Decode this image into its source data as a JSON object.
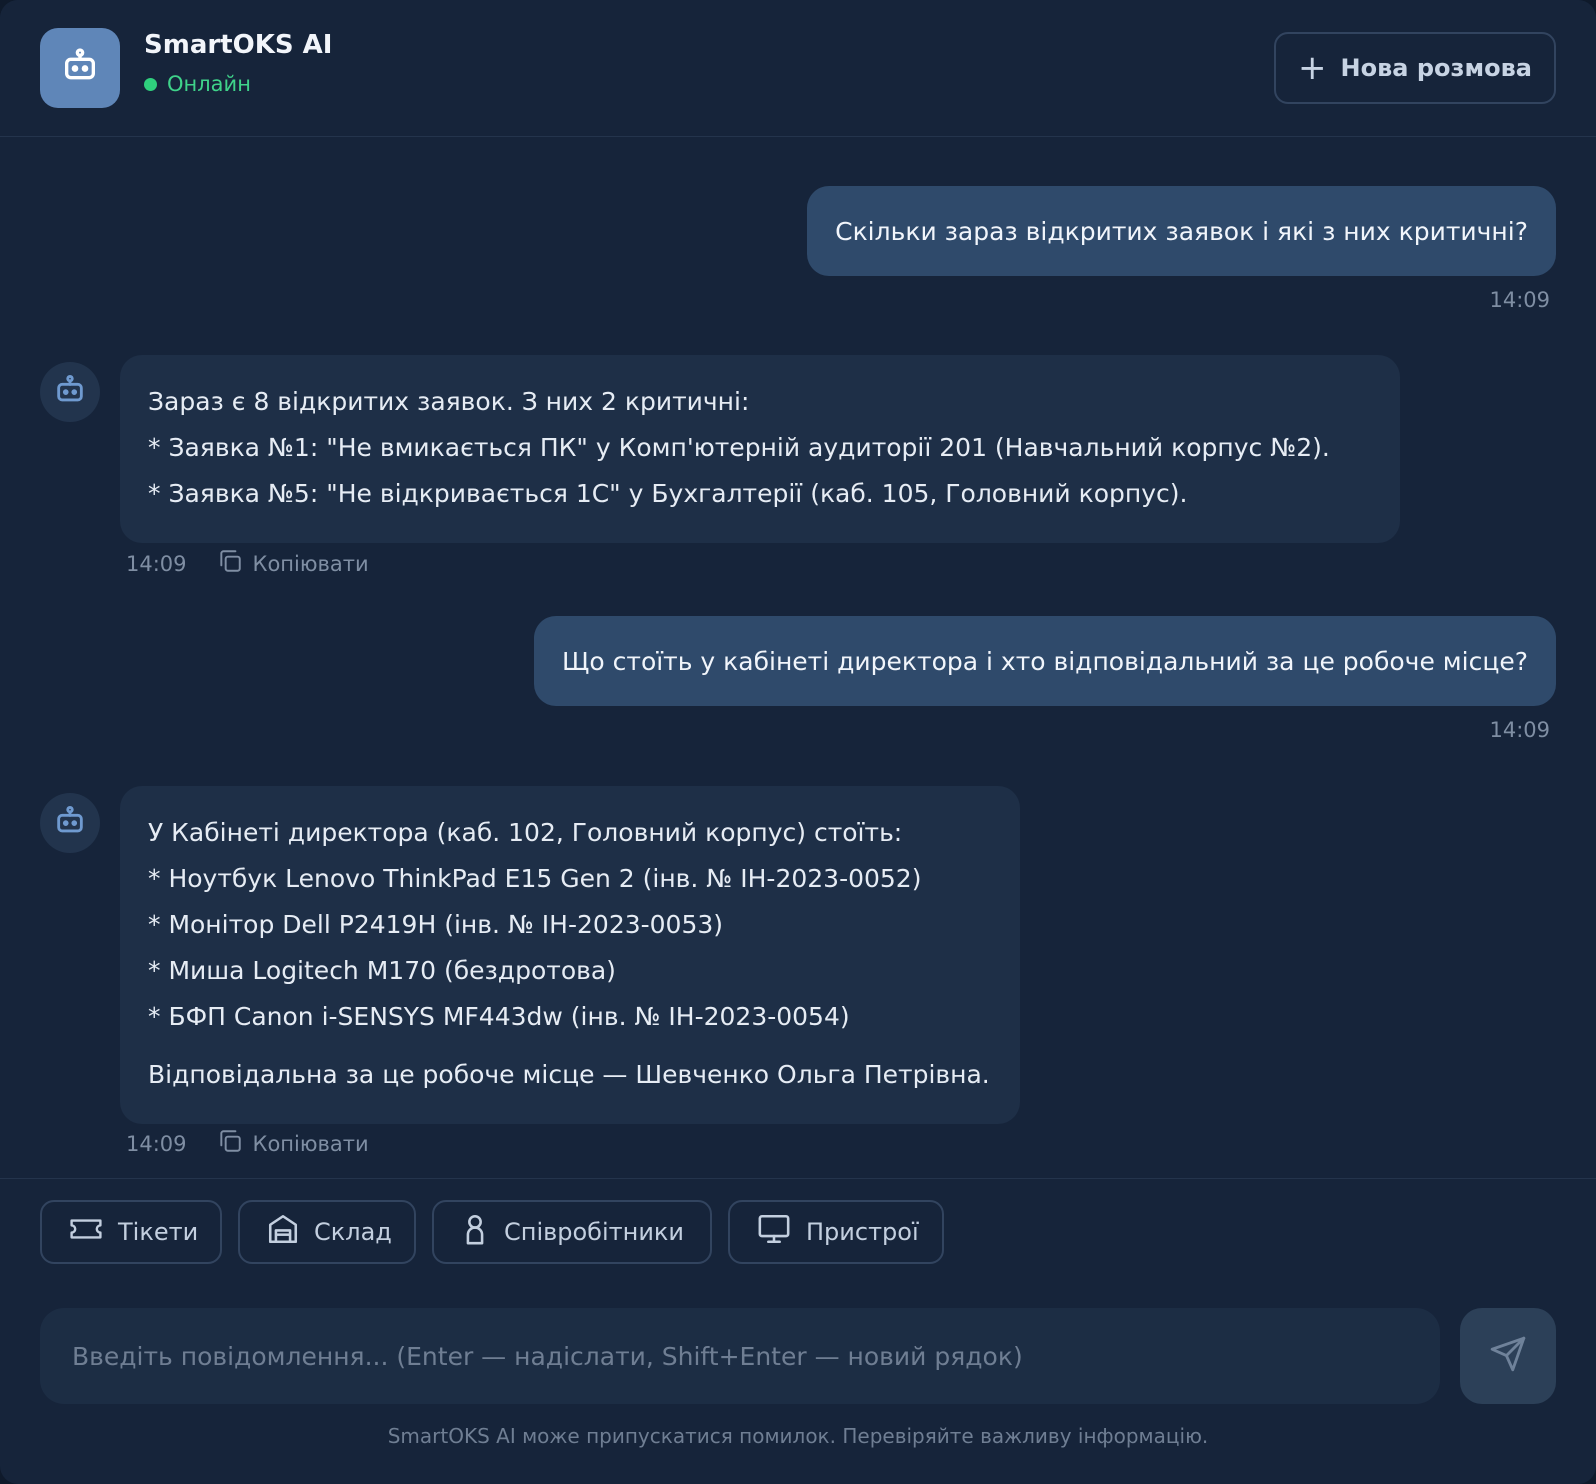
{
  "header": {
    "title": "SmartOKS AI",
    "status": "Онлайн",
    "new_chat_label": "Нова розмова"
  },
  "messages": [
    {
      "role": "user",
      "text": "Скільки зараз відкритих заявок і які з них критичні?",
      "time": "14:09"
    },
    {
      "role": "assistant",
      "lines": [
        "Зараз є 8 відкритих заявок. З них 2 критичні:",
        "* Заявка №1: \"Не вмикається ПК\" у Комп'ютерній аудиторії 201 (Навчальний корпус №2).",
        "* Заявка №5: \"Не відкривається 1С\" у Бухгалтерії (каб. 105, Головний корпус)."
      ],
      "time": "14:09",
      "copy_label": "Копіювати"
    },
    {
      "role": "user",
      "text": "Що стоїть у кабінеті директора і хто відповідальний за це робоче місце?",
      "time": "14:09"
    },
    {
      "role": "assistant",
      "lines": [
        "У Кабінеті директора (каб. 102, Головний корпус) стоїть:",
        "* Ноутбук Lenovo ThinkPad E15 Gen 2 (інв. № ІН-2023-0052)",
        "* Монітор Dell P2419H (інв. № ІН-2023-0053)",
        "* Миша Logitech M170 (бездротова)",
        "* БФП Canon i-SENSYS MF443dw (інв. № ІН-2023-0054)"
      ],
      "footer_line": "Відповідальна за це робоче місце — Шевченко Ольга Петрівна.",
      "time": "14:09",
      "copy_label": "Копіювати"
    }
  ],
  "quick_actions": [
    {
      "label": "Тікети",
      "icon": "ticket-icon"
    },
    {
      "label": "Склад",
      "icon": "warehouse-icon"
    },
    {
      "label": "Співробітники",
      "icon": "person-icon"
    },
    {
      "label": "Пристрої",
      "icon": "monitor-icon"
    }
  ],
  "composer": {
    "placeholder": "Введіть повідомлення... (Enter — надіслати, Shift+Enter — новий рядок)",
    "value": ""
  },
  "disclaimer": "SmartOKS AI може припускатися помилок. Перевіряйте важливу інформацію.",
  "colors": {
    "background": "#16243a",
    "user_bubble": "#2f4a6b",
    "bot_bubble": "#1e2f47",
    "online": "#2fcf7d",
    "accent_logo": "#5f86b8"
  }
}
